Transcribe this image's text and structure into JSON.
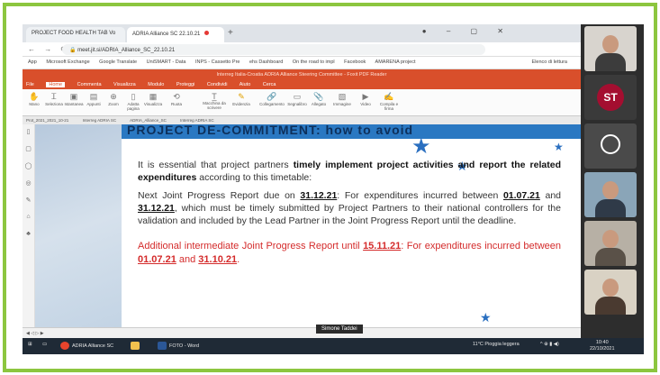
{
  "browser": {
    "tabs": [
      {
        "label": "PROJECT FOOD HEALTH TAB Vo",
        "active": false
      },
      {
        "label": "ADRIA Alliance SC 22.10.21",
        "active": true
      }
    ],
    "url": "meet.jit.si/ADRIA_Alliance_SC_22.10.21",
    "bookmarks": [
      "App",
      "Microsoft Exchange",
      "Google Translate",
      "UniSMART - Data",
      "INPS - Cassetto Pre",
      "ehs Dashboard",
      "On the road to impl",
      "Facebook",
      "AMARENA project",
      "Elenco di lettura"
    ]
  },
  "pdf_app": {
    "title": "Interreg Italia-Croatia ADRIA Alliance Steering Committee - Foxit PDF Reader",
    "ribbon_tabs": [
      "File",
      "Home",
      "Commenta",
      "Visualizza",
      "Modulo",
      "Proteggi",
      "Condividi",
      "Aiuto",
      "Cerca"
    ],
    "selected_ribbon_tab": "Home",
    "ribbon_buttons": [
      "Mano",
      "Seleziona",
      "Istantanea",
      "Appunti",
      "Zoom",
      "Adatta pagina",
      "Visualizza",
      "Ruota",
      "Macchina da scrivere",
      "Evidenzia",
      "Collegamento",
      "Segnalibro",
      "Allegato",
      "Immagine",
      "Video",
      "Compila e firma"
    ],
    "doc_tabs": [
      "Prot_2021_2021_10-21",
      "Interreg ADRIA SC",
      "ADRIA_Alliance_SC",
      "Interreg ADRIA SC"
    ],
    "side_tool_icons": [
      "bookmark-icon",
      "pages-icon",
      "comment-icon",
      "layers-icon",
      "attachment-icon",
      "signature-icon",
      "security-icon"
    ]
  },
  "slide": {
    "heading": "PROJECT DE-COMMITMENT: how to avoid",
    "intro_pre": "It is essential that project partners ",
    "intro_bold": "timely implement project activities and report the related expenditures",
    "intro_post": " according to this timetable:",
    "next_pre": "Next Joint Progress Report due on ",
    "next_date": "31.12.21",
    "next_mid1": ": For expenditures incurred between ",
    "next_from": "01.07.21",
    "next_mid2": " and ",
    "next_to": "31.12.21",
    "next_post": ", which must be timely submitted by Project Partners to their national controllers for the validation and included by the Lead Partner in the Joint Progress Report until the deadline.",
    "add_pre": "Additional intermediate Joint Progress Report until ",
    "add_date": "15.11.21",
    "add_mid1": ": For expenditures incurred between ",
    "add_from": "01.07.21",
    "add_mid2": " and ",
    "add_to": "31.10.21",
    "add_post": "."
  },
  "meeting": {
    "speaker_name": "Simone Taddei",
    "participant_initials": "ST"
  },
  "taskbar": {
    "items": [
      "ADRIA Alliance SC",
      "Esplora file",
      "FOTO - Word"
    ],
    "weather": "11°C Pioggia leggera",
    "time": "10:40",
    "date": "22/10/2021"
  },
  "colors": {
    "frame_border": "#8cc63f",
    "heading_band": "#2a78c2",
    "red_text": "#d42b2b",
    "app_accent": "#d94f2b"
  }
}
